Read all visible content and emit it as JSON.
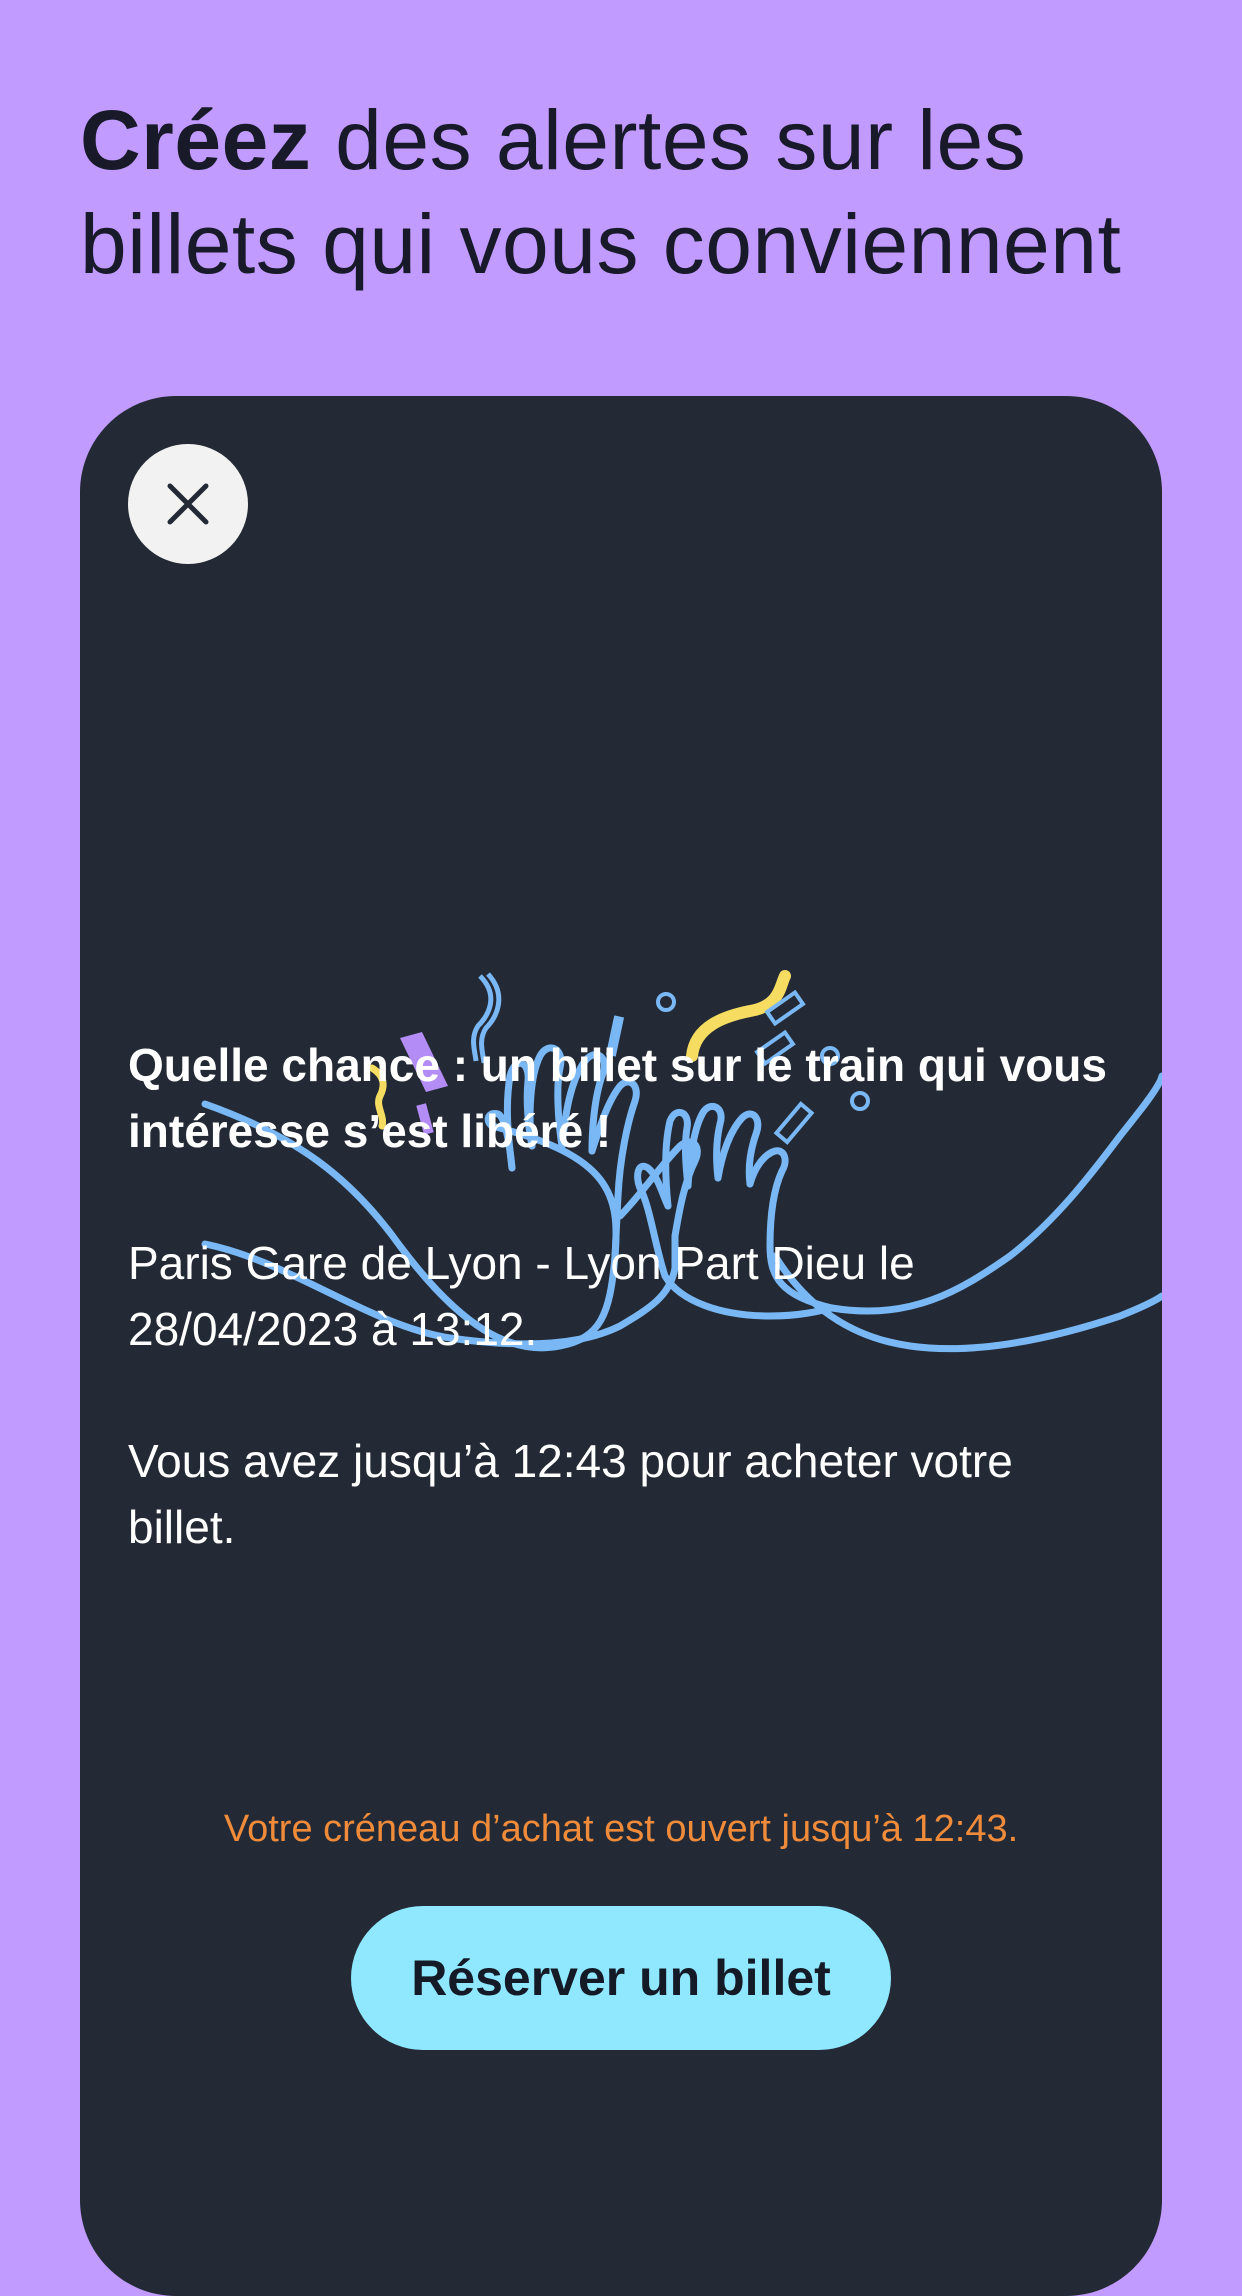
{
  "header": {
    "title_bold": "Créez",
    "title_rest": " des alertes sur les billets qui vous conviennent"
  },
  "card": {
    "close_icon": "close-icon",
    "illustration": "high-five-illustration",
    "message_title": "Quelle chance : un billet sur le train qui vous intéresse s’est libéré !",
    "route": "Paris Gare de Lyon - Lyon Part Dieu le 28/04/2023 à 13:12.",
    "deadline": "Vous avez jusqu’à 12:43 pour acheter votre billet.",
    "purchase_window": "Votre créneau d’achat est ouvert jusqu’à 12:43.",
    "book_button": "Réserver un billet"
  },
  "colors": {
    "background": "#c19bff",
    "card": "#242a35",
    "accent_button": "#8fe8ff",
    "warning_text": "#f08b3a",
    "illustration_line": "#79b8f5",
    "confetti_yellow": "#f6dd62",
    "confetti_purple": "#b48cf5"
  }
}
